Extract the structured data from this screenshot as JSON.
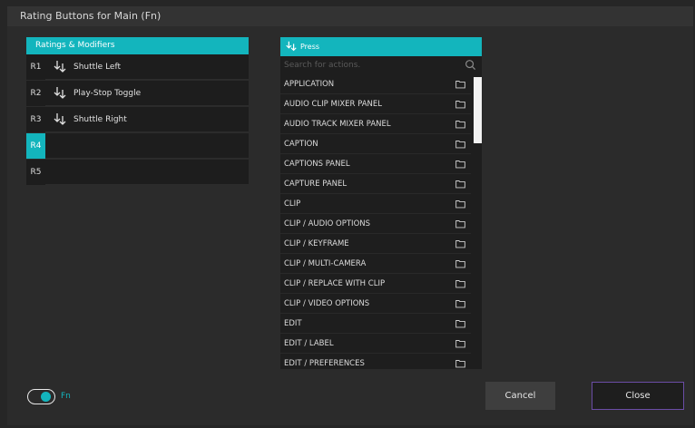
{
  "dialog": {
    "title": "Rating Buttons for Main (Fn)"
  },
  "ratings": {
    "header": "Ratings & Modifiers",
    "rows": [
      {
        "id": "R1",
        "label": "Shuttle Left",
        "has_icon": true
      },
      {
        "id": "R2",
        "label": "Play-Stop Toggle",
        "has_icon": true
      },
      {
        "id": "R3",
        "label": "Shuttle Right",
        "has_icon": true
      },
      {
        "id": "R4",
        "label": "",
        "has_icon": false,
        "selected": true
      },
      {
        "id": "R5",
        "label": "",
        "has_icon": false
      }
    ]
  },
  "actions": {
    "header": "Press",
    "search_placeholder": "Search for actions.",
    "items": [
      "APPLICATION",
      "AUDIO CLIP MIXER PANEL",
      "AUDIO TRACK MIXER PANEL",
      "CAPTION",
      "CAPTIONS PANEL",
      "CAPTURE PANEL",
      "CLIP",
      "CLIP / AUDIO OPTIONS",
      "CLIP / KEYFRAME",
      "CLIP / MULTI-CAMERA",
      "CLIP / REPLACE WITH CLIP",
      "CLIP / VIDEO OPTIONS",
      "EDIT",
      "EDIT / LABEL",
      "EDIT / PREFERENCES"
    ]
  },
  "footer": {
    "fn_label": "Fn",
    "fn_enabled": true,
    "cancel_label": "Cancel",
    "close_label": "Close"
  },
  "colors": {
    "accent": "#13b5bd",
    "close_border": "#6b4da6",
    "background": "#2b2b2b"
  }
}
